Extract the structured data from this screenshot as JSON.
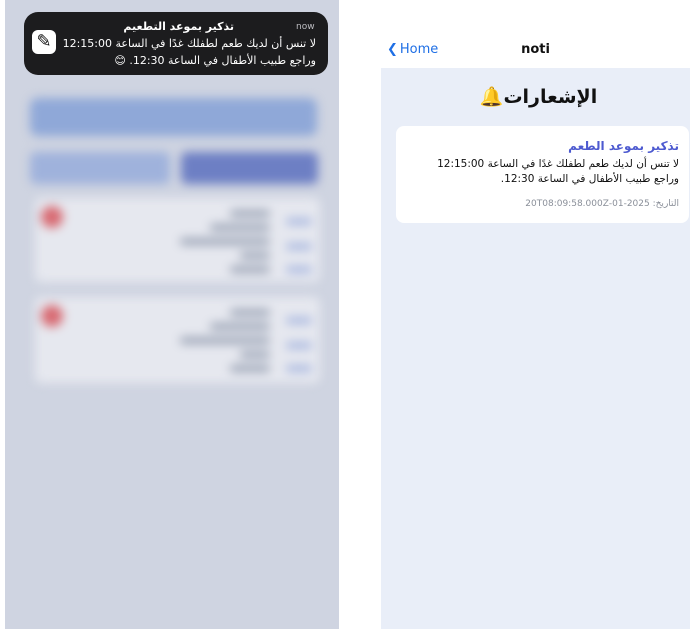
{
  "left": {
    "banner": {
      "title": "تذكير بموعد التطعيم",
      "time": "now",
      "line1": "لا تنس أن لديك طعم لطفلك غدًا في الساعة 12:15:00",
      "line2": "وراجع طبيب الأطفال في الساعة 12:30. 😊",
      "icon": "app-icon"
    }
  },
  "right": {
    "nav": {
      "back_label": "Home",
      "title": "noti"
    },
    "heading": "الإشعارات",
    "heading_icon": "bell-icon",
    "notification": {
      "title": "تذكير بموعد الطعم",
      "line1": "لا تنس أن لديك طعم لطفلك غدًا في الساعة 12:15:00",
      "line2": "وراجع طبيب الأطفال في الساعة 12:30.",
      "date": "التاريخ: 2025-01-20T08:09:58.000Z"
    }
  },
  "colors": {
    "accent": "#4d5ad0",
    "link": "#1f6fe5",
    "background": "#e9eef8",
    "banner": "#1c1c1e"
  }
}
